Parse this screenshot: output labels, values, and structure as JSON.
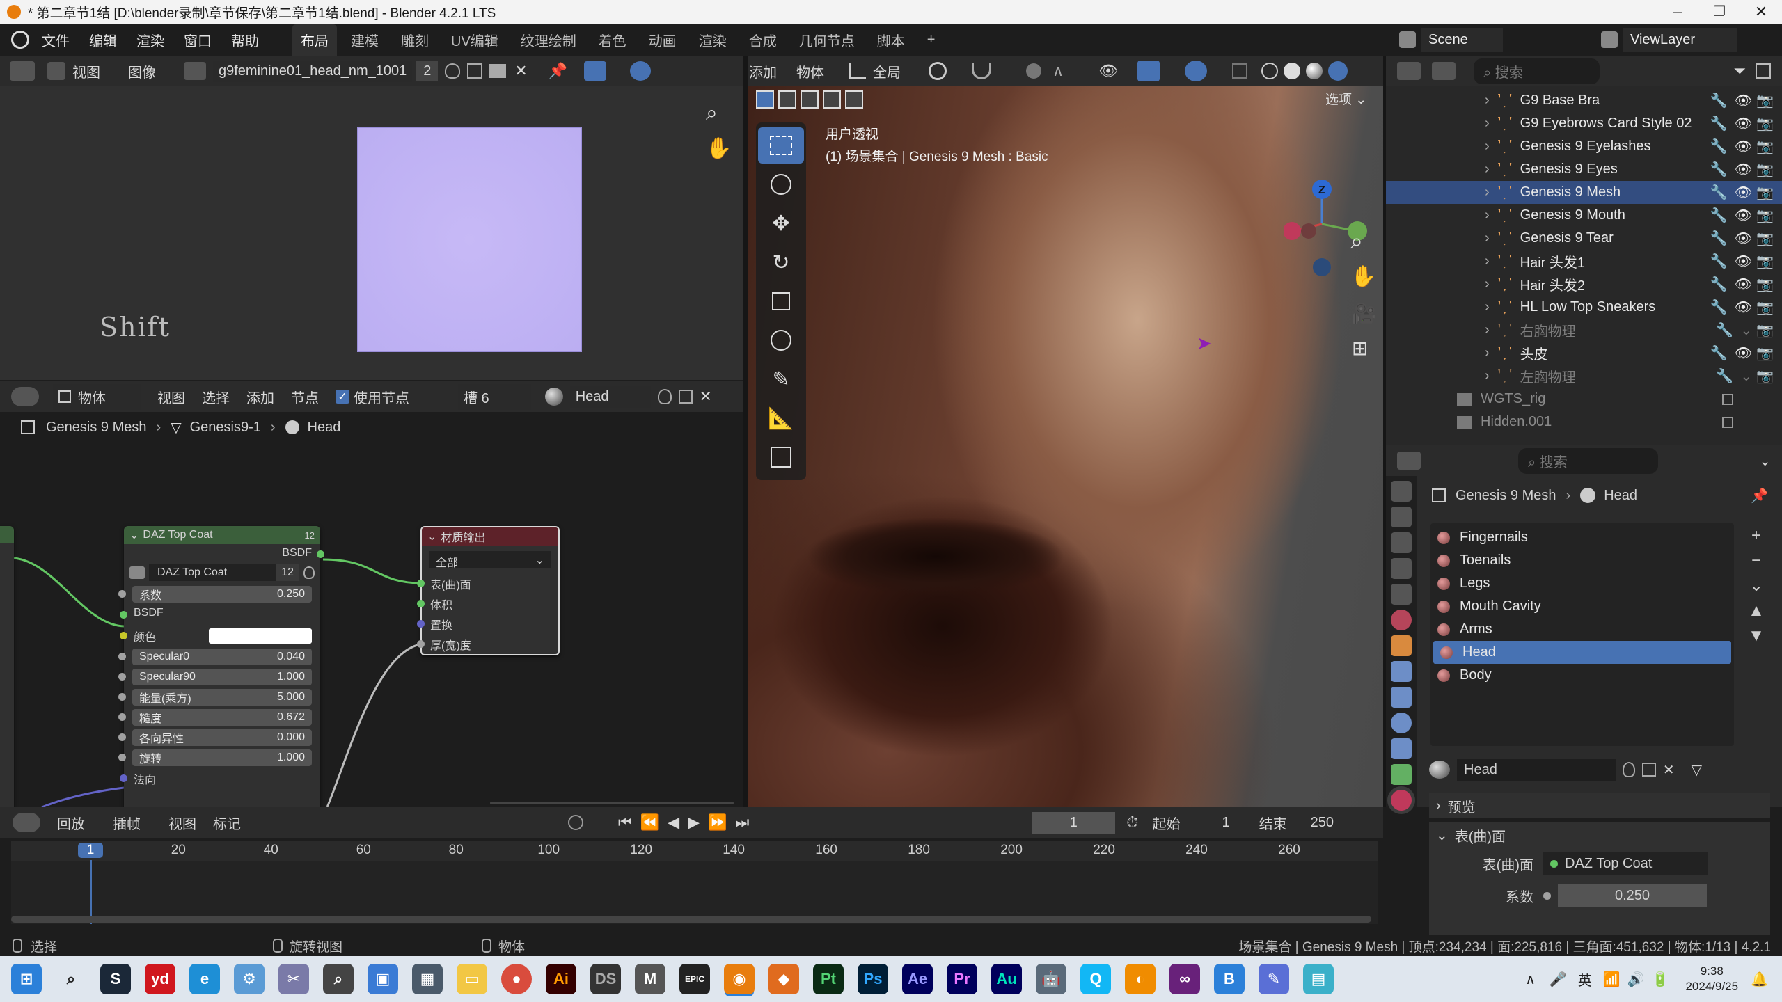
{
  "window": {
    "title": "* 第二章节1结 [D:\\blender录制\\章节保存\\第二章节1结.blend] - Blender 4.2.1 LTS"
  },
  "menu": {
    "items": [
      "文件",
      "编辑",
      "渲染",
      "窗口",
      "帮助"
    ],
    "workspaces": [
      "布局",
      "建模",
      "雕刻",
      "UV编辑",
      "纹理绘制",
      "着色",
      "动画",
      "渲染",
      "合成",
      "几何节点",
      "脚本"
    ],
    "active_ws": "布局",
    "plus": "+"
  },
  "scene": {
    "label": "Scene",
    "viewlayer": "ViewLayer"
  },
  "image_editor": {
    "menus": [
      "视图",
      "图像"
    ],
    "image_name": "g9feminine01_head_nm_1001",
    "users": "2",
    "shift_label": "Shift",
    "texture_color": "#c7b9f6"
  },
  "node_editor": {
    "mode": "物体",
    "menus": [
      "视图",
      "选择",
      "添加",
      "节点"
    ],
    "use_nodes": "使用节点",
    "slot": "槽 6",
    "material": "Head",
    "breadcrumb": [
      "Genesis 9 Mesh",
      "Genesis9-1",
      "Head"
    ],
    "topcoat": {
      "title": "DAZ Top Coat",
      "badge": "12",
      "out": "BSDF",
      "group": "DAZ Top Coat",
      "group_count": "12",
      "fields": [
        {
          "label": "系数",
          "value": "0.250"
        },
        {
          "label": "Specular0",
          "value": "0.040"
        },
        {
          "label": "Specular90",
          "value": "1.000"
        },
        {
          "label": "能量(乘方)",
          "value": "5.000"
        },
        {
          "label": "糙度",
          "value": "0.672"
        },
        {
          "label": "各向异性",
          "value": "0.000"
        },
        {
          "label": "旋转",
          "value": "1.000"
        }
      ],
      "bsdf_in": "BSDF",
      "color_label": "颜色",
      "normal": "法向"
    },
    "output": {
      "title": "材质输出",
      "target": "全部",
      "inputs": [
        "表(曲)面",
        "体积",
        "置换",
        "厚(宽)度"
      ]
    }
  },
  "viewport": {
    "menus": [
      "添加",
      "物体"
    ],
    "transform": "全局",
    "options": "选项",
    "view_name": "用户透视",
    "collection_info": "(1) 场景集合 | Genesis 9 Mesh : Basic"
  },
  "outliner": {
    "search": "搜索",
    "items": [
      {
        "name": "G9 Base Bra",
        "dim": false,
        "sel": false
      },
      {
        "name": "G9 Eyebrows Card Style 02",
        "dim": false,
        "sel": false
      },
      {
        "name": "Genesis 9 Eyelashes",
        "dim": false,
        "sel": false
      },
      {
        "name": "Genesis 9 Eyes",
        "dim": false,
        "sel": false
      },
      {
        "name": "Genesis 9 Mesh",
        "dim": false,
        "sel": true
      },
      {
        "name": "Genesis 9 Mouth",
        "dim": false,
        "sel": false
      },
      {
        "name": "Genesis 9 Tear",
        "dim": false,
        "sel": false
      },
      {
        "name": "Hair 头发1",
        "dim": false,
        "sel": false
      },
      {
        "name": "Hair 头发2",
        "dim": false,
        "sel": false
      },
      {
        "name": "HL Low Top Sneakers",
        "dim": false,
        "sel": false
      },
      {
        "name": "右胸物理",
        "dim": true,
        "sel": false
      },
      {
        "name": "头皮",
        "dim": false,
        "sel": false
      },
      {
        "name": "左胸物理",
        "dim": true,
        "sel": false
      }
    ],
    "collections": [
      "WGTS_rig",
      "Hidden.001"
    ]
  },
  "properties": {
    "search": "搜索",
    "breadcrumb": [
      "Genesis 9 Mesh",
      "Head"
    ],
    "slots": [
      "Fingernails",
      "Toenails",
      "Legs",
      "Mouth Cavity",
      "Arms",
      "Head",
      "Body"
    ],
    "active_slot": "Head",
    "material": "Head",
    "preview": "预览",
    "surface_panel": "表(曲)面",
    "surface_label": "表(曲)面",
    "surface_value": "DAZ Top Coat",
    "coef_label": "系数",
    "coef_value": "0.250"
  },
  "timeline": {
    "menus": [
      "回放",
      "插帧",
      "视图",
      "标记"
    ],
    "frame": "1",
    "start_label": "起始",
    "start": "1",
    "end_label": "结束",
    "end": "250",
    "ticks": [
      "1",
      "20",
      "40",
      "60",
      "80",
      "100",
      "120",
      "140",
      "160",
      "180",
      "200",
      "220",
      "240",
      "260"
    ]
  },
  "statusbar": {
    "select": "选择",
    "rotate": "旋转视图",
    "object": "物体",
    "stats": "场景集合 | Genesis 9 Mesh | 顶点:234,234 | 面:225,816 | 三角面:451,632 | 物体:1/13 | 4.2.1"
  },
  "taskbar": {
    "time": "9:38",
    "date": "2024/9/25",
    "ime": "英"
  }
}
